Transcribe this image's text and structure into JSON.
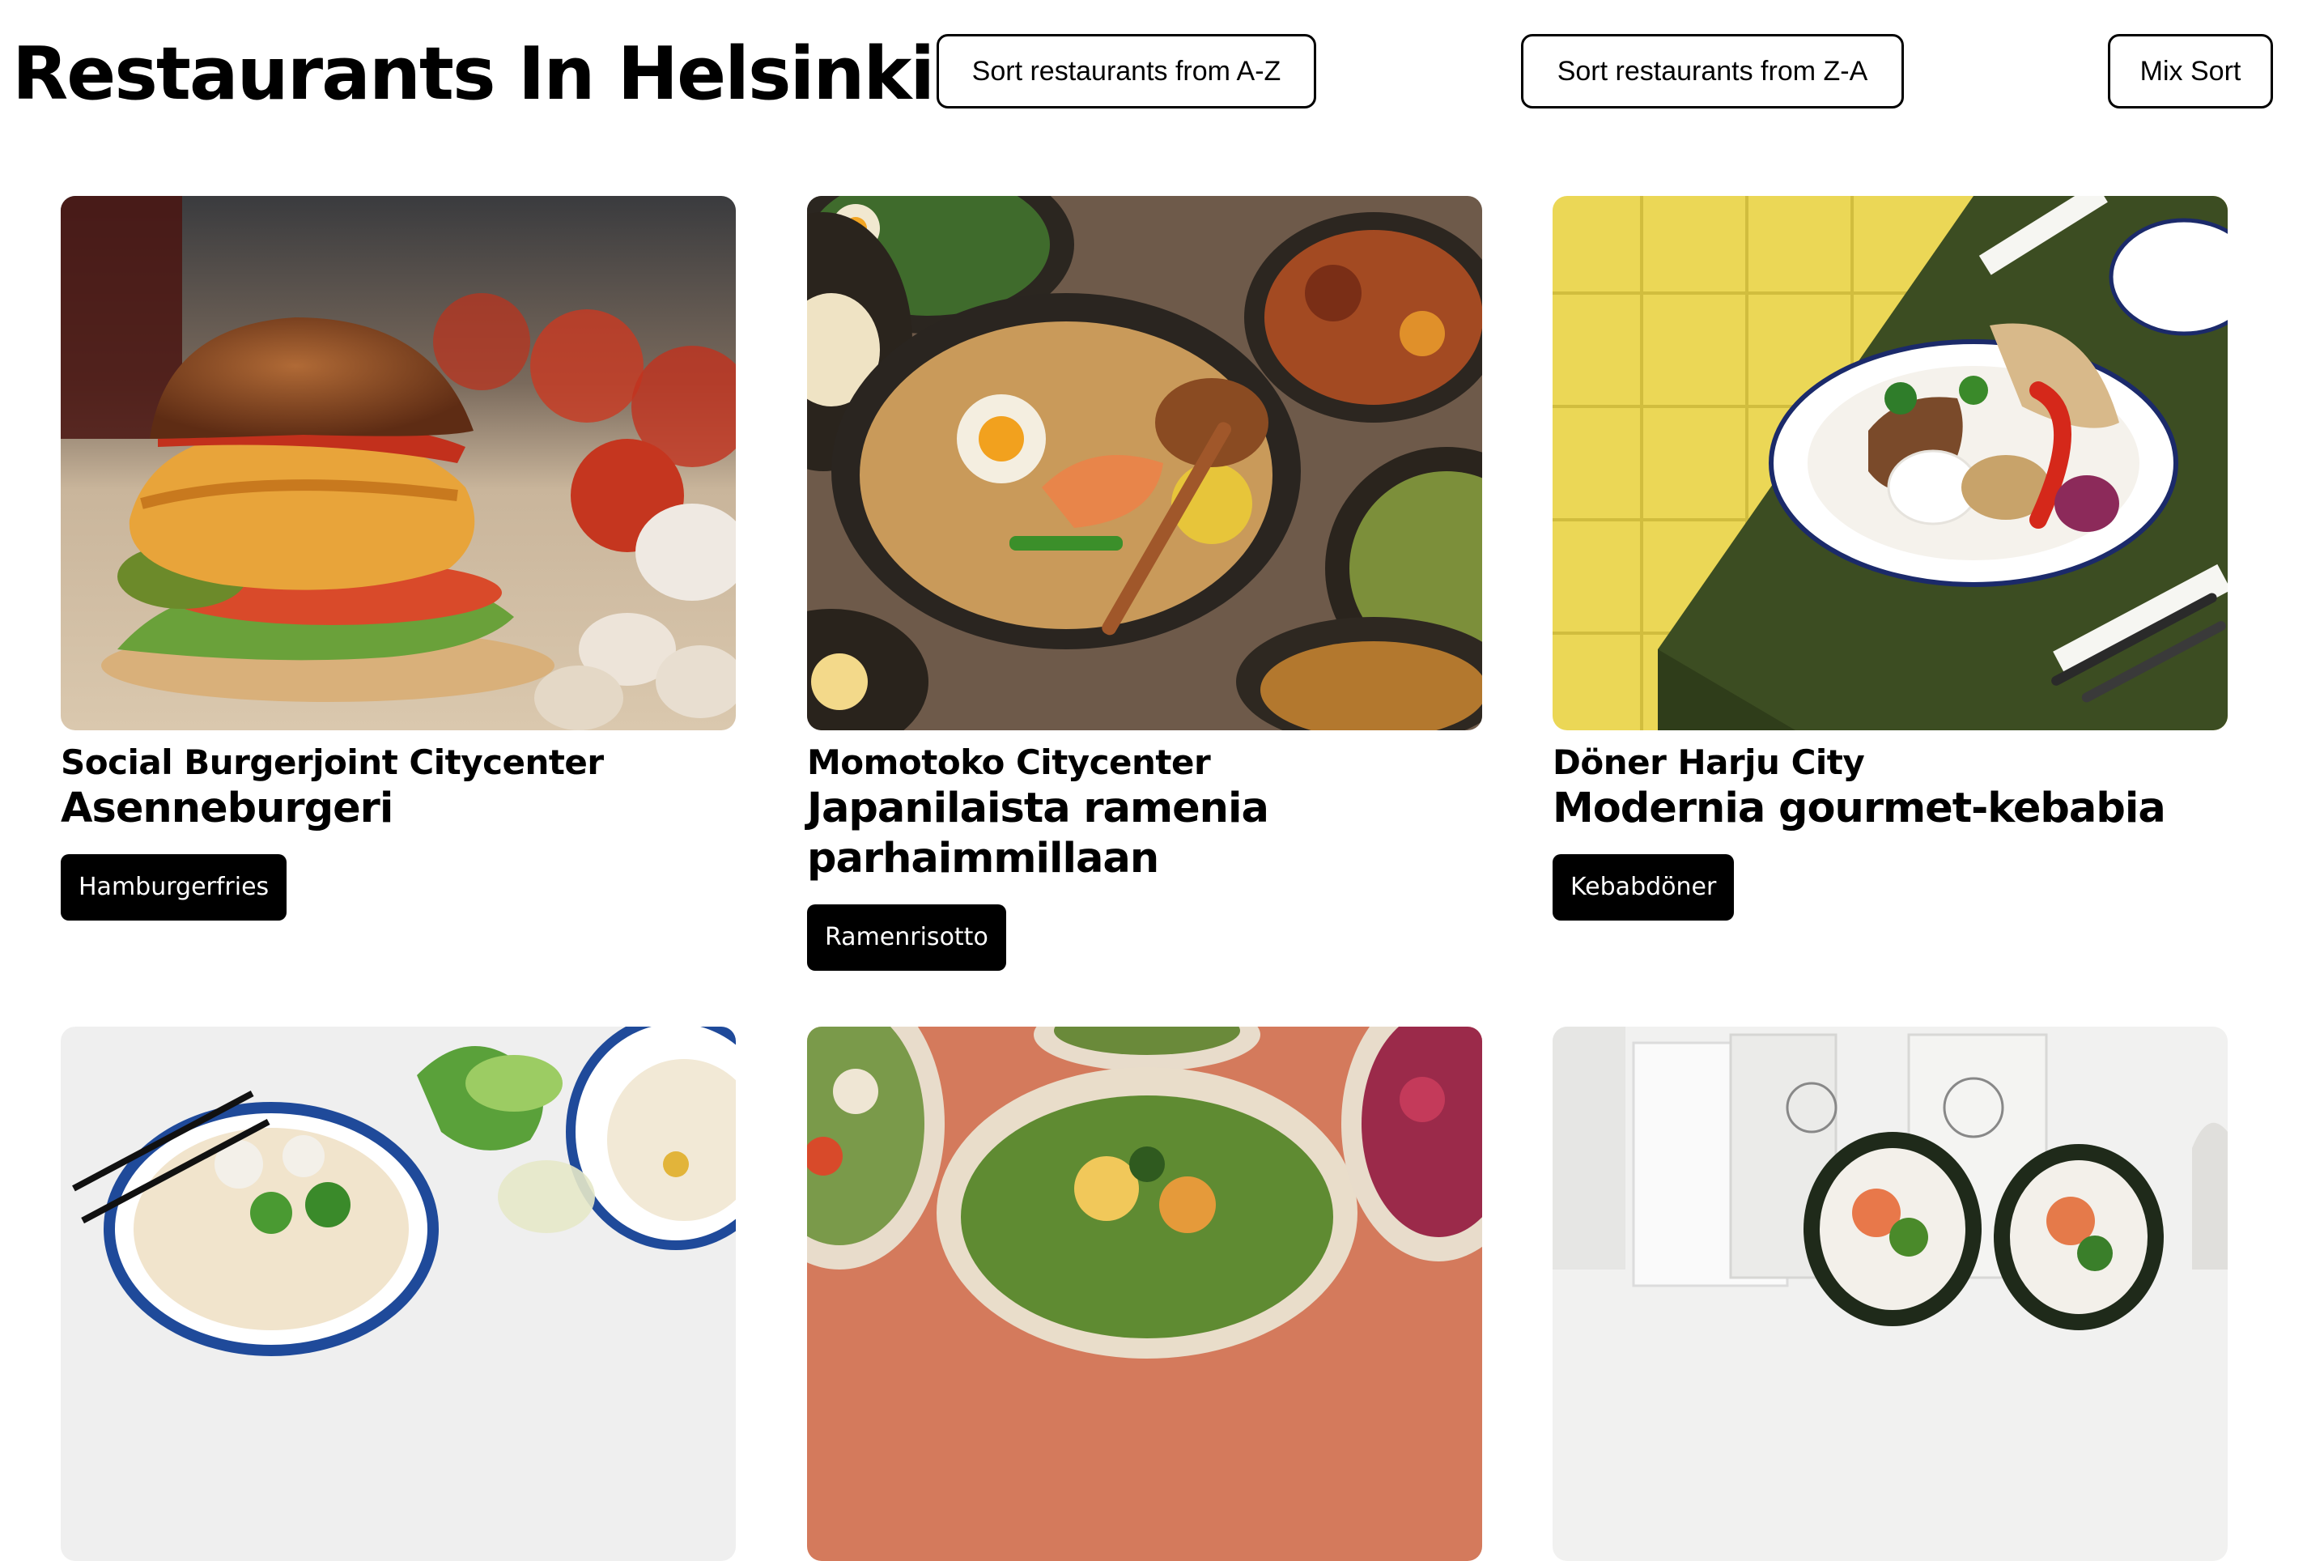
{
  "page": {
    "title": "Restaurants In Helsinki"
  },
  "controls": {
    "sort_az_label": "Sort restaurants from A-Z",
    "sort_za_label": "Sort restaurants from Z-A",
    "mix_sort_label": "Mix Sort"
  },
  "restaurants": [
    {
      "name": "Social Burgerjoint Citycenter",
      "tagline": "Asenneburgeri",
      "tag": "Hamburgerfries",
      "image": "burger-photo"
    },
    {
      "name": "Momotoko Citycenter",
      "tagline": "Japanilaista ramenia parhaimmillaan",
      "tag": "Ramenrisotto",
      "image": "ramen-photo"
    },
    {
      "name": "Döner Harju City",
      "tagline": "Modernia gourmet-kebabia",
      "tag": "Kebabdöner",
      "image": "kebab-plate-photo"
    },
    {
      "image": "noodle-soup-photo"
    },
    {
      "image": "salad-bowls-photo"
    },
    {
      "image": "sushi-burrito-photo"
    }
  ],
  "colors": {
    "button_border": "#000000",
    "tag_background": "#000000",
    "tag_text": "#ffffff"
  }
}
